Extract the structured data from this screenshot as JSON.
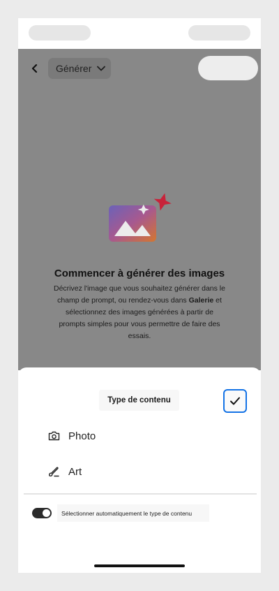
{
  "header": {
    "dropdown_label": "Générer"
  },
  "empty_state": {
    "title": "Commencer à générer des images",
    "desc_part1": "Décrivez l'image que vous souhaitez générer dans le champ de prompt, ou rendez-vous dans ",
    "desc_bold": "Galerie",
    "desc_part2": " et sélectionnez des images générées à partir de prompts simples pour vous permettre de faire des essais."
  },
  "sheet": {
    "title": "Type de contenu",
    "options": [
      {
        "label": "Photo",
        "icon": "camera-icon"
      },
      {
        "label": "Art",
        "icon": "brush-icon"
      }
    ],
    "auto_select_label": "Sélectionner automatiquement le type de contenu",
    "auto_select_on": true
  },
  "colors": {
    "accent": "#1473e6",
    "overlay": "#888888",
    "sparkle": "#d0243a"
  }
}
